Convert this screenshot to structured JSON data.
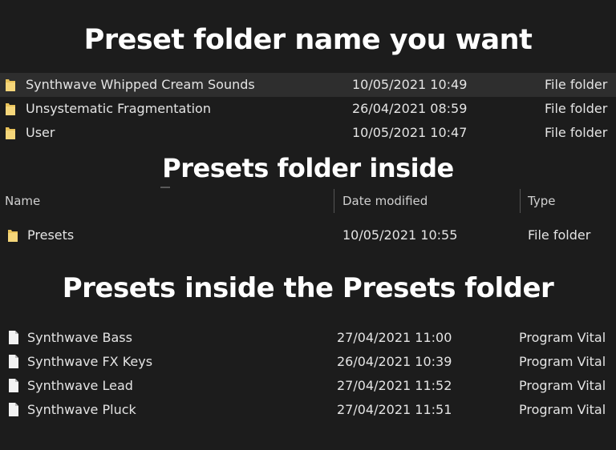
{
  "headings": {
    "top": "Preset folder name you want",
    "middle": "Presets folder inside",
    "bottom": "Presets inside the Presets folder"
  },
  "colors": {
    "background": "#1c1c1c",
    "selected_row": "#2e2e2e",
    "folder_icon": "#e8c25a",
    "text": "#e4e4e4"
  },
  "preset_folders": [
    {
      "name": "Synthwave Whipped Cream Sounds",
      "date": "10/05/2021 10:49",
      "type": "File folder",
      "icon": "folder-icon",
      "selected": true
    },
    {
      "name": "Unsystematic Fragmentation",
      "date": "26/04/2021 08:59",
      "type": "File folder",
      "icon": "folder-icon",
      "selected": false
    },
    {
      "name": "User",
      "date": "10/05/2021 10:47",
      "type": "File folder",
      "icon": "folder-icon",
      "selected": false
    }
  ],
  "columns": {
    "name": "Name",
    "date": "Date modified",
    "type": "Type"
  },
  "inner_folder": {
    "name": "Presets",
    "date": "10/05/2021 10:55",
    "type": "File folder",
    "icon": "folder-icon"
  },
  "preset_files": [
    {
      "name": "Synthwave Bass",
      "date": "27/04/2021 11:00",
      "type": "Program Vital",
      "icon": "file-icon"
    },
    {
      "name": "Synthwave FX Keys",
      "date": "26/04/2021 10:39",
      "type": "Program Vital",
      "icon": "file-icon"
    },
    {
      "name": "Synthwave Lead",
      "date": "27/04/2021 11:52",
      "type": "Program Vital",
      "icon": "file-icon"
    },
    {
      "name": "Synthwave Pluck",
      "date": "27/04/2021 11:51",
      "type": "Program Vital",
      "icon": "file-icon"
    }
  ]
}
